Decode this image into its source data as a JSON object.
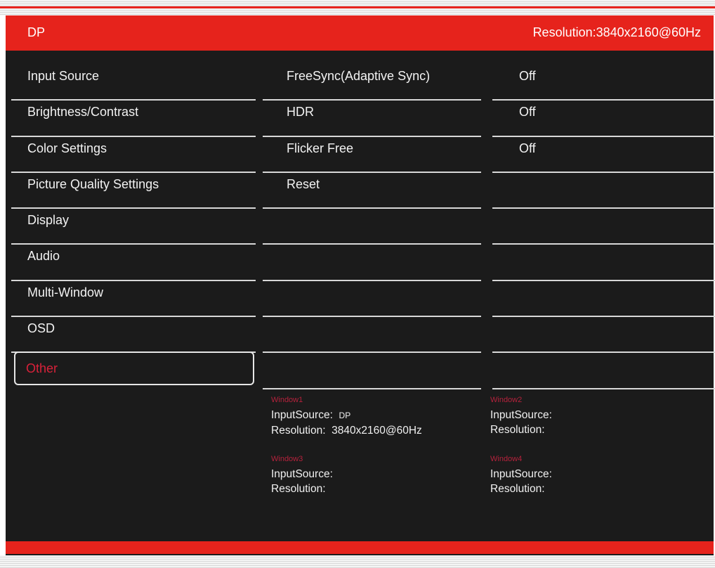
{
  "header": {
    "source": "DP",
    "resolution": "Resolution:3840x2160@60Hz"
  },
  "menu": {
    "items": [
      {
        "label": "Input Source"
      },
      {
        "label": "Brightness/Contrast"
      },
      {
        "label": "Color Settings"
      },
      {
        "label": "Picture Quality Settings"
      },
      {
        "label": "Display"
      },
      {
        "label": "Audio"
      },
      {
        "label": "Multi-Window"
      },
      {
        "label": "OSD"
      },
      {
        "label": "Other",
        "selected": true
      }
    ]
  },
  "submenu": {
    "items": [
      {
        "label": "FreeSync(Adaptive Sync)",
        "value": "Off"
      },
      {
        "label": "HDR",
        "value": "Off"
      },
      {
        "label": "Flicker Free",
        "value": "Off"
      },
      {
        "label": "Reset",
        "value": ""
      }
    ]
  },
  "windows": {
    "w1": {
      "title": "Window1",
      "input_label": "InputSource:",
      "input_value": "DP",
      "res_label": "Resolution:",
      "res_value": "3840x2160@60Hz"
    },
    "w2": {
      "title": "Window2",
      "input_label": "InputSource:",
      "input_value": "",
      "res_label": "Resolution:",
      "res_value": ""
    },
    "w3": {
      "title": "Window3",
      "input_label": "InputSource:",
      "input_value": "",
      "res_label": "Resolution:",
      "res_value": ""
    },
    "w4": {
      "title": "Window4",
      "input_label": "InputSource:",
      "input_value": "",
      "res_label": "Resolution:",
      "res_value": ""
    }
  },
  "colors": {
    "accent_red": "#e6231c",
    "selected_text": "#d8213a",
    "background": "#1b1b1b",
    "text": "#f2f2f2"
  }
}
